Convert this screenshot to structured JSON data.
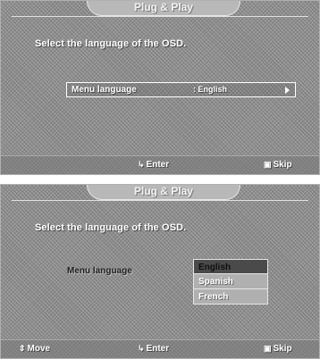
{
  "screens": [
    {
      "title": "Plug & Play",
      "prompt": "Select the language of the OSD.",
      "field": {
        "label": "Menu language",
        "value": ": English"
      },
      "help": {
        "enter": "Enter",
        "skip": "Skip"
      }
    },
    {
      "title": "Plug & Play",
      "prompt": "Select the language of the OSD.",
      "field": {
        "label": "Menu language"
      },
      "options": [
        "English",
        "Spanish",
        "French"
      ],
      "selected_option": "English",
      "help": {
        "move": "Move",
        "enter": "Enter",
        "skip": "Skip"
      }
    }
  ],
  "icons": {
    "move": "updown-arrows-icon",
    "enter": "enter-icon",
    "skip": "skip-icon",
    "submenu": "right-triangle-icon"
  }
}
